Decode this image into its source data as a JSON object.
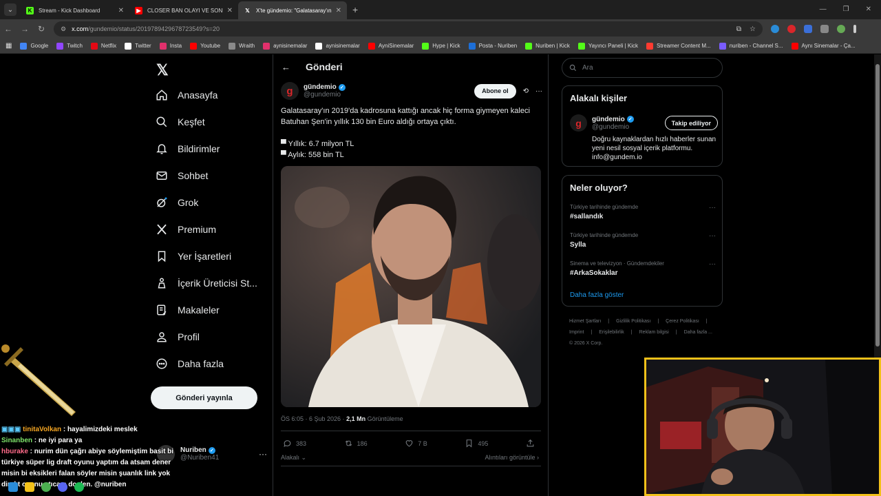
{
  "tabs": [
    {
      "title": "Stream - Kick Dashboard",
      "favicon": "kick-icon",
      "color": "#53fc18"
    },
    {
      "title": "CLOSER BAN OLAYI VE SONRA",
      "favicon": "youtube-icon",
      "color": "#ff0000"
    },
    {
      "title": "X'te gündemio: \"Galatasaray'ın",
      "favicon": "x-icon",
      "color": "#ffffff",
      "active": true
    }
  ],
  "address": {
    "domain": "x.com",
    "path": "/gundemio/status/2019789429678723549?s=20"
  },
  "bookmarks": [
    "Google",
    "Twitch",
    "Netflix",
    "Twitter",
    "Insta",
    "Youtube",
    "Wraith",
    "aynisinemalar",
    "aynisinemalar",
    "AyniSinemalar",
    "Hype | Kick",
    "Posta - Nuriben",
    "Nuriben | Kick",
    "Yayıncı Paneli | Kick",
    "Streamer Content M...",
    "nuriben - Channel S...",
    "Aynı Sinemalar - Ça..."
  ],
  "nav": {
    "items": [
      "Anasayfa",
      "Keşfet",
      "Bildirimler",
      "Sohbet",
      "Grok",
      "Premium",
      "Yer İşaretleri",
      "İçerik Üreticisi St...",
      "Makaleler",
      "Profil",
      "Daha fazla"
    ],
    "post_button": "Gönderi yayınla",
    "account": {
      "name": "Nuriben",
      "handle": "@Nuriben41"
    }
  },
  "header": {
    "title": "Gönderi"
  },
  "tweet": {
    "name": "gündemio",
    "handle": "@gundemio",
    "subscribe": "Abone ol",
    "text": "Galatasaray'ın 2019'da kadrosuna kattığı ancak hiç forma giymeyen kaleci Batuhan Şen'in yıllık 130 bin Euro aldığı ortaya çıktı.\n\n▀ Yıllık: 6.7 milyon TL\n▀ Aylık: 558 bin TL",
    "time": "ÖS 6:05 · 6 Şub 2026 · ",
    "views_count": "2,1 Mn",
    "views_label": " Görüntüleme",
    "replies": "383",
    "reposts": "186",
    "likes": "7 B",
    "bookmarks": "495",
    "related_left": "Alakalı",
    "related_right": "Alıntıları görüntüle"
  },
  "sidebar": {
    "search_placeholder": "Ara",
    "relevant_title": "Alakalı kişiler",
    "person": {
      "name": "gündemio",
      "handle": "@gundemio",
      "button": "Takip ediliyor",
      "bio": "Doğru kaynaklardan hızlı haberler sunan yeni nesil sosyal içerik platformu. info@gundem.io"
    },
    "trends_title": "Neler oluyor?",
    "trends": [
      {
        "context": "Türkiye tarihinde gündemde",
        "tag": "#sallandık"
      },
      {
        "context": "Türkiye tarihinde gündemde",
        "tag": "Sylla"
      },
      {
        "context": "Sinema ve televizyon · Gündemdekiler",
        "tag": "#ArkaSokaklar"
      }
    ],
    "show_more": "Daha fazla göster",
    "footer": [
      "Hizmet Şartları",
      "Gizlilik Politikası",
      "Çerez Politikası",
      "Imprint",
      "Erişilebilirlik",
      "Reklam bilgisi",
      "Daha fazla ...",
      "© 2026 X Corp."
    ]
  },
  "chat": [
    {
      "user": "tinitaVolkan",
      "msg": " : hayalimizdeki meslek"
    },
    {
      "user": "Sinanben",
      "msg": " : ne iyi para ya"
    },
    {
      "user": "hburake",
      "msg": " : nurim dün çağrı abiye söylemiştim basit bi türkiye süper lig draft oyunu yaptım da atsam dener misin bi eksikleri falan söyler misin şuanlık link yok direkt oyunu atıcam dc den. @nuriben"
    }
  ]
}
